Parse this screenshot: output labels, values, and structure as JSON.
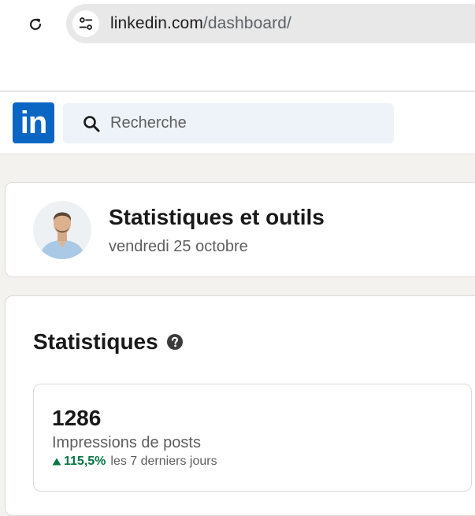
{
  "browser": {
    "url_host": "linkedin.com",
    "url_path": "/dashboard/"
  },
  "header": {
    "logo_text": "in",
    "search_placeholder": "Recherche",
    "brand_color": "#0a66c2"
  },
  "profile": {
    "title": "Statistiques et outils",
    "date": "vendredi 25 octobre"
  },
  "stats": {
    "heading": "Statistiques",
    "metrics": [
      {
        "value": "1286",
        "label": "Impressions de posts",
        "change": "115,5%",
        "change_direction": "up",
        "period": "les 7 derniers jours",
        "change_color": "#057642"
      }
    ]
  }
}
